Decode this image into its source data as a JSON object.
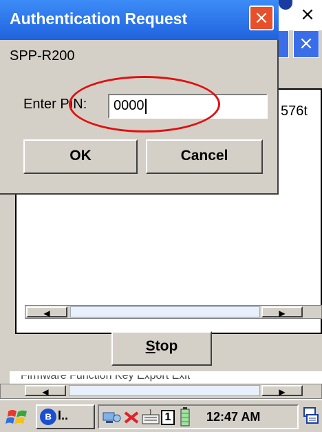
{
  "dialog": {
    "title": "Authentication Request",
    "device_name": "SPP-R200",
    "pin_label": "Enter PIN:",
    "pin_value": "0000",
    "ok_label": "OK",
    "cancel_label": "Cancel",
    "close_glyph": "×"
  },
  "background_window": {
    "close_glyph": "×",
    "list_fragment": "576t",
    "stop_label_first": "S",
    "stop_label_rest": "top",
    "footer_fragment": "Firmware  Function Key  Export  Exit"
  },
  "taskbar": {
    "bluetooth_task_label": "I..",
    "tray_number": "1",
    "clock": "12:47 AM"
  },
  "icons": {
    "start": "windows-flag-icon",
    "bluetooth": "bluetooth-icon",
    "network": "network-icon",
    "disconnected": "disconnect-icon",
    "keyboard": "keyboard-icon",
    "battery": "battery-icon",
    "sip": "input-panel-icon"
  },
  "colors": {
    "titlebar_blue": "#1f62de",
    "close_red": "#e8502a",
    "annotation_red": "#e01010",
    "panel_gray": "#d4d0c8"
  }
}
